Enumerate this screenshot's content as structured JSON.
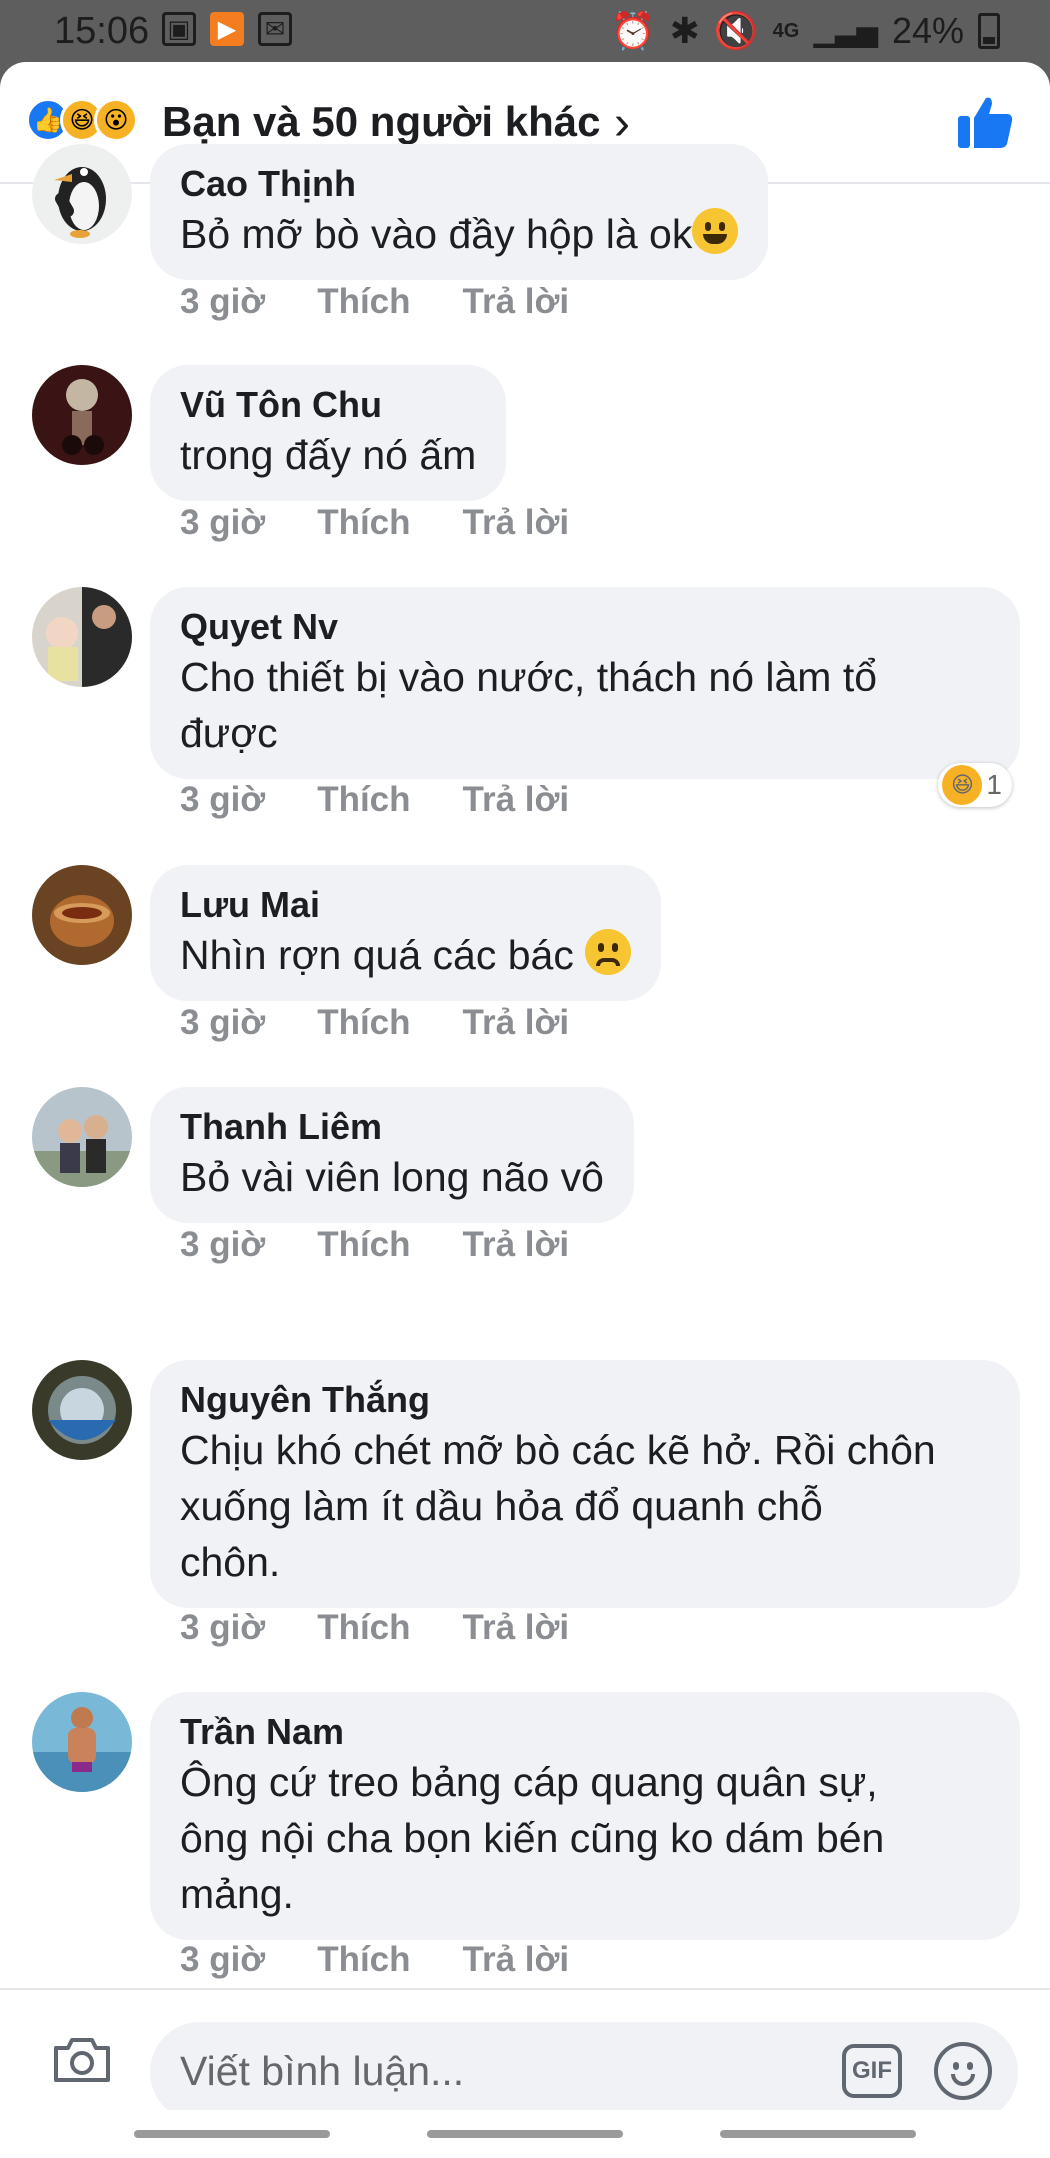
{
  "status": {
    "time": "15:06",
    "battery": "24%",
    "network": "4G"
  },
  "header": {
    "reactions_label": "Bạn và 50 người khác"
  },
  "comments": [
    {
      "name": "Cao Thịnh",
      "text": "Bỏ mỡ bò vào đầy hộp là ok",
      "emoji": "grinning-emoji",
      "time": "3 giờ",
      "like": "Thích",
      "reply": "Trả lời"
    },
    {
      "name": "Vũ Tôn Chu",
      "text": "trong đấy nó ấm",
      "time": "3 giờ",
      "like": "Thích",
      "reply": "Trả lời"
    },
    {
      "name": "Quyet Nv",
      "line1": "Cho thiết bị vào nước, thách nó làm tổ",
      "line2": "được",
      "time": "3 giờ",
      "like": "Thích",
      "reply": "Trả lời",
      "reaction_count": "1"
    },
    {
      "name": "Lưu Mai",
      "text": "Nhìn rợn quá các bác",
      "emoji": "frowning-emoji",
      "time": "3 giờ",
      "like": "Thích",
      "reply": "Trả lời"
    },
    {
      "name": "Thanh Liêm",
      "text": "Bỏ vài viên long não vô",
      "time": "3 giờ",
      "like": "Thích",
      "reply": "Trả lời"
    },
    {
      "name": "Nguyên Thắng",
      "line1": "Chịu khó chét mỡ bò các kẽ hở. Rồi chôn",
      "line2": "xuống làm ít dầu hỏa đổ quanh chỗ",
      "line3": "chôn.",
      "time": "3 giờ",
      "like": "Thích",
      "reply": "Trả lời"
    },
    {
      "name": "Trần Nam",
      "line1": "Ông cứ treo bảng cáp quang quân sự,",
      "line2": "ông nội cha bọn kiến cũng ko dám bén",
      "line3": "mảng.",
      "time": "3 giờ",
      "like": "Thích",
      "reply": "Trả lời"
    }
  ],
  "composer": {
    "placeholder": "Viết bình luận...",
    "gif_label": "GIF"
  },
  "colors": {
    "accent": "#1877f2",
    "bubble": "#f0f2f5",
    "meta": "#8a8d91"
  }
}
